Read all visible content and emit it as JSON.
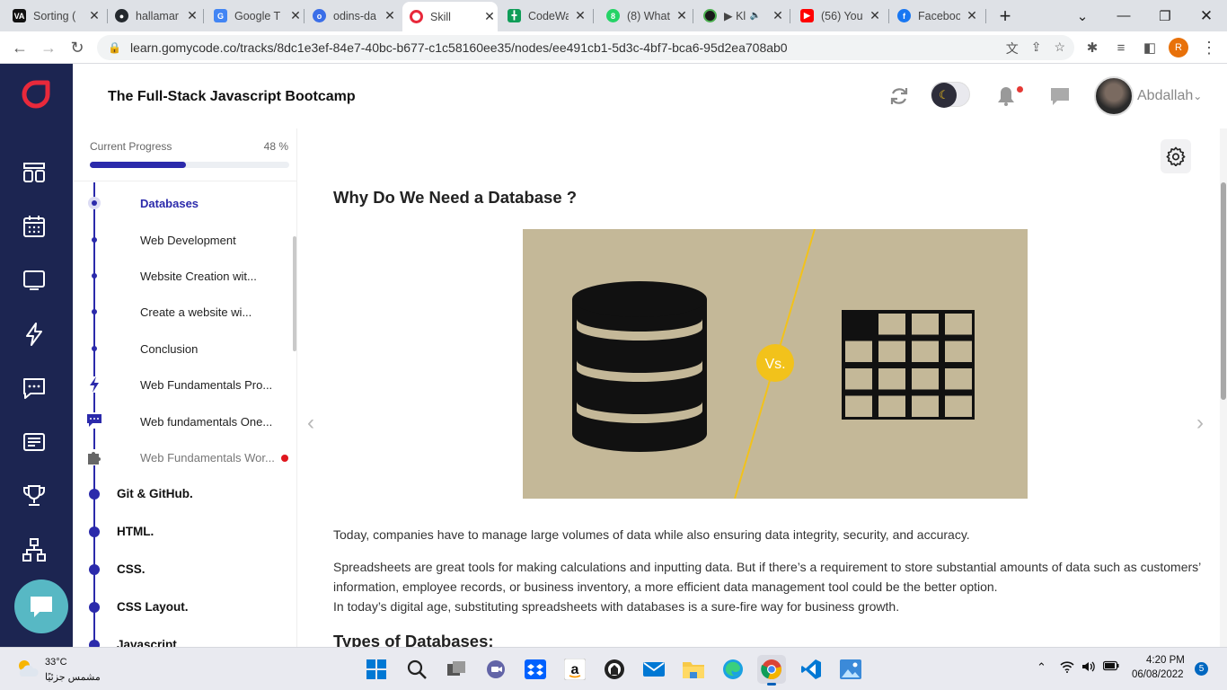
{
  "browser": {
    "tabs": [
      {
        "title": "Sorting (",
        "favicon": "VA",
        "color": "#111111"
      },
      {
        "title": "hallamar",
        "favicon": "github-icon",
        "color": "#24292e"
      },
      {
        "title": "Google T",
        "favicon": "google-translate-icon",
        "color": "#4285f4"
      },
      {
        "title": "odins-da",
        "favicon": "odin-icon",
        "color": "#3a6ee8"
      },
      {
        "title": "Skill",
        "favicon": "gomycode-icon",
        "color": "#e8293b"
      },
      {
        "title": "CodeWa",
        "favicon": "sheets-icon",
        "color": "#0f9d58"
      },
      {
        "title": "(8) What",
        "favicon": "8",
        "color": "#25d366"
      },
      {
        "title": "▶ Kl",
        "favicon": "media-icon",
        "color": "#1a1a1a"
      },
      {
        "title": "(56) You",
        "favicon": "youtube-icon",
        "color": "#ff0000"
      },
      {
        "title": "Faceboo",
        "favicon": "facebook-icon",
        "color": "#1877f2"
      }
    ],
    "new_tab": "+",
    "url": "learn.gomycode.co/tracks/8dc1e3ef-84e7-40bc-b677-c1c58160ee35/nodes/ee491cb1-5d3c-4bf7-bca6-95d2ea708ab0",
    "profile_initial": "R"
  },
  "header": {
    "course_title": "The Full-Stack Javascript Bootcamp",
    "username": "Abdallah",
    "accent": "#e8293b"
  },
  "progress": {
    "label": "Current Progress",
    "percent_text": "48 %",
    "value": 0.48
  },
  "nav": {
    "items": [
      {
        "label": "Databases",
        "kind": "ring",
        "active": true
      },
      {
        "label": "Web Development",
        "kind": "dot"
      },
      {
        "label": "Website Creation wit...",
        "kind": "dot"
      },
      {
        "label": "Create a website wi...",
        "kind": "dot"
      },
      {
        "label": "Conclusion",
        "kind": "dot"
      },
      {
        "label": "Web Fundamentals Pro...",
        "kind": "bolt-icon"
      },
      {
        "label": "Web fundamentals One...",
        "kind": "chat-icon"
      },
      {
        "label": "Web Fundamentals Wor...",
        "kind": "puzzle-icon"
      }
    ],
    "sections": [
      "Git & GitHub.",
      "HTML.",
      "CSS.",
      "CSS Layout.",
      "Javascript"
    ]
  },
  "content": {
    "title": "Why Do We Need a Database ?",
    "figure_vs": "Vs.",
    "paragraphs": [
      "Today, companies have to manage large volumes of data while also ensuring data integrity, security, and accuracy.",
      "Spreadsheets are great tools for making calculations and inputting data. But if there’s a requirement to store substantial amounts of data such as customers’",
      "information, employee records, or business inventory, a more efficient data management tool could be the better option.",
      "In today’s digital age, substituting spreadsheets with databases is a sure-fire way for business growth."
    ],
    "next_heading": "Types of Databases:"
  },
  "taskbar": {
    "temperature": "33°C",
    "weather": "مشمس جزئيًا",
    "time": "4:20 PM",
    "date": "06/08/2022",
    "notifications": "5"
  }
}
